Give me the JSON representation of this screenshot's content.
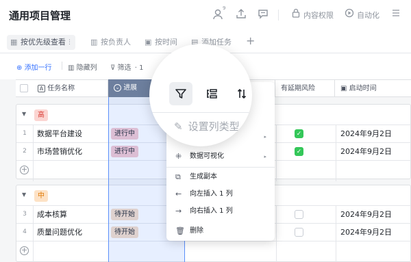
{
  "app": {
    "title": "通用项目管理"
  },
  "topbar": {
    "badge": "9",
    "content_permission": "内容权限",
    "automation": "自动化"
  },
  "views": [
    {
      "label": "按优先级查看",
      "icon": "grid-icon"
    },
    {
      "label": "按负责人",
      "icon": "kanban-icon"
    },
    {
      "label": "按时间",
      "icon": "calendar-icon"
    },
    {
      "label": "添加任务",
      "icon": "form-icon"
    }
  ],
  "toolbar": {
    "add_row": "添加一行",
    "hide_cols": "隐藏列",
    "filter": "筛选",
    "filter_count": "1"
  },
  "columns": {
    "name": "任务名称",
    "progress": "进展",
    "risk": "有延期风险",
    "start": "启动时间"
  },
  "groups": [
    {
      "tag": "高",
      "tag_color": "#fbd5d2",
      "tag_text_color": "#d83931",
      "rows": [
        {
          "n": "1",
          "name": "数据平台建设",
          "status": "进行中",
          "status_color": "#f3c6cd",
          "risk": true,
          "date": "2024年9月2日"
        },
        {
          "n": "2",
          "name": "市场营销优化",
          "status": "进行中",
          "status_color": "#f3c6cd",
          "risk": true,
          "date": "2024年9月2日"
        }
      ]
    },
    {
      "tag": "中",
      "tag_color": "#fde2c6",
      "tag_text_color": "#de7802",
      "rows": [
        {
          "n": "3",
          "name": "成本核算",
          "status": "待开始",
          "status_color": "#f5dcc6",
          "risk": false,
          "date": "2024年9月2日"
        },
        {
          "n": "4",
          "name": "质量问题优化",
          "status": "待开始",
          "status_color": "#f5dcc6",
          "risk": false,
          "date": "2024年9月2日"
        }
      ]
    }
  ],
  "menu": {
    "items": [
      {
        "label": "数据可视化",
        "icon": "sparkle-icon",
        "submenu": true
      },
      {
        "label": "生成副本",
        "icon": "copy-icon",
        "submenu": false
      },
      {
        "label": "向左插入 1 列",
        "icon": "arrow-left-icon",
        "submenu": false
      },
      {
        "label": "向右插入 1 列",
        "icon": "arrow-right-icon",
        "submenu": false
      },
      {
        "label": "删除",
        "icon": "trash-icon",
        "submenu": false
      }
    ]
  },
  "magnifier": {
    "set_column_type": "设置列类型"
  }
}
